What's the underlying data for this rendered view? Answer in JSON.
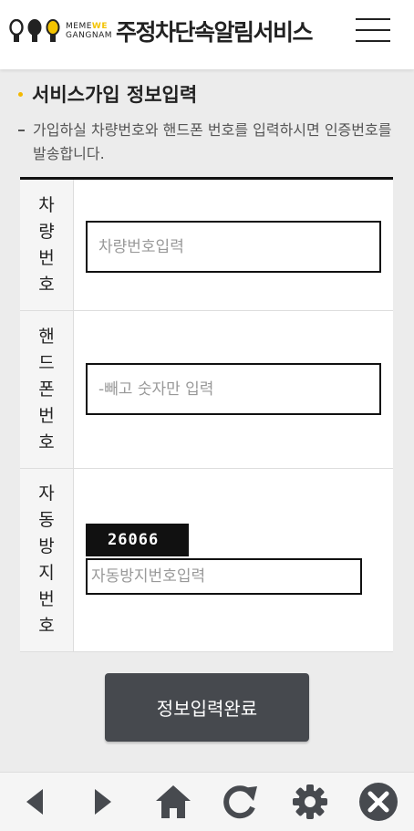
{
  "header": {
    "logo_line1": "ME ME WE",
    "logo_me1": "ME",
    "logo_me2": "ME",
    "logo_we": "WE",
    "logo_line2": "GANGNAM",
    "title": "주정차단속알림서비스",
    "menu_icon": "hamburger-menu-icon"
  },
  "section": {
    "title": "서비스가입 정보입력",
    "description": "가입하실 차량번호와 핸드폰 번호를 입력하시면 인증번호를 발송합니다."
  },
  "form": {
    "rows": [
      {
        "label": "차량번호",
        "placeholder": "차량번호입력",
        "value": ""
      },
      {
        "label": "핸드폰번호",
        "placeholder": "-빼고 숫자만 입력",
        "value": ""
      },
      {
        "label": "자동방지번호",
        "placeholder": "자동방지번호입력",
        "value": "",
        "captcha": "26066"
      }
    ]
  },
  "submit_label": "정보입력완료",
  "navbar": {
    "items": [
      "back-icon",
      "forward-icon",
      "home-icon",
      "refresh-icon",
      "settings-icon",
      "close-icon"
    ]
  },
  "colors": {
    "accent": "#f3c300",
    "button": "#46494e",
    "nav_icon": "#474a4f"
  }
}
